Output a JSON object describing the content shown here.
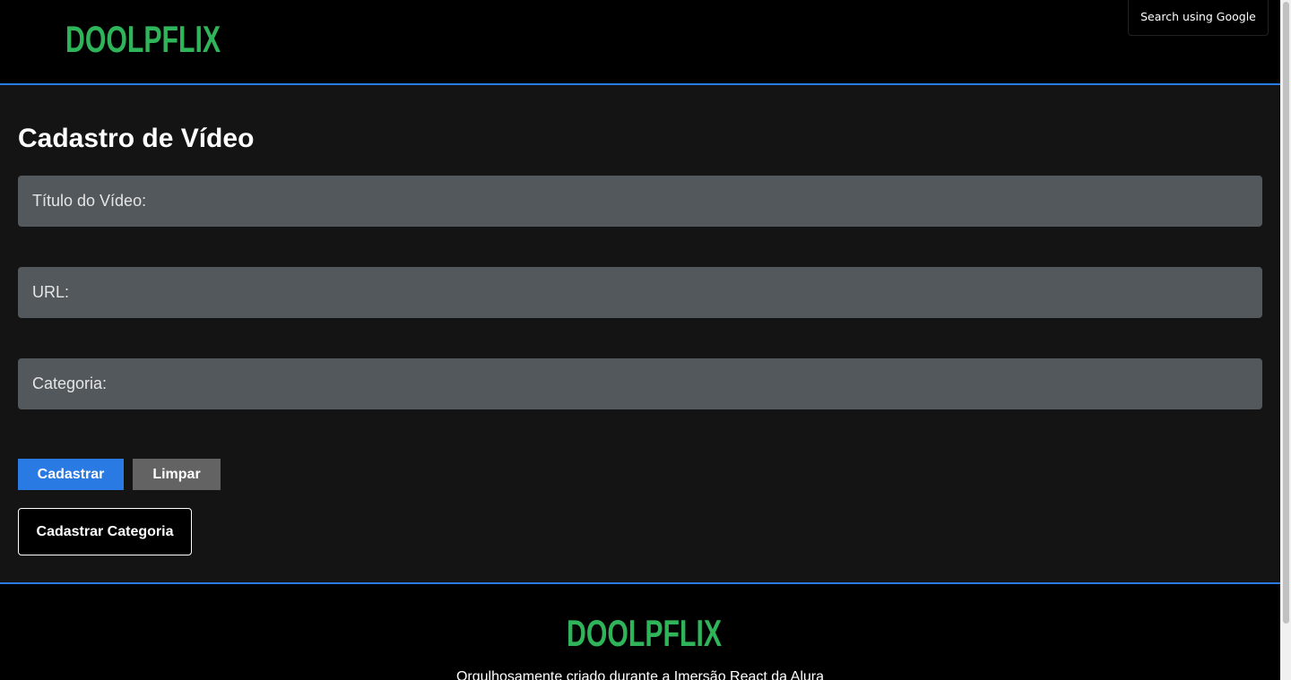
{
  "header": {
    "logo_text": "DOOLPFLIX",
    "search_google_label": "Search using Google"
  },
  "main": {
    "title": "Cadastro de Vídeo",
    "fields": {
      "titulo": {
        "label": "Título do Vídeo:",
        "value": ""
      },
      "url": {
        "label": "URL:",
        "value": ""
      },
      "categoria": {
        "label": "Categoria:",
        "value": ""
      }
    },
    "buttons": {
      "cadastrar": "Cadastrar",
      "limpar": "Limpar",
      "cadastrar_categoria": "Cadastrar Categoria"
    }
  },
  "footer": {
    "logo_text": "DOOLPFLIX",
    "text": "Orgulhosamente criado durante a Imersão React da Alura"
  },
  "colors": {
    "brand_green": "#2fb45a",
    "accent_blue": "#2a7ae4",
    "background": "#141414",
    "input_bg": "#53585d",
    "secondary_button": "#636363"
  }
}
